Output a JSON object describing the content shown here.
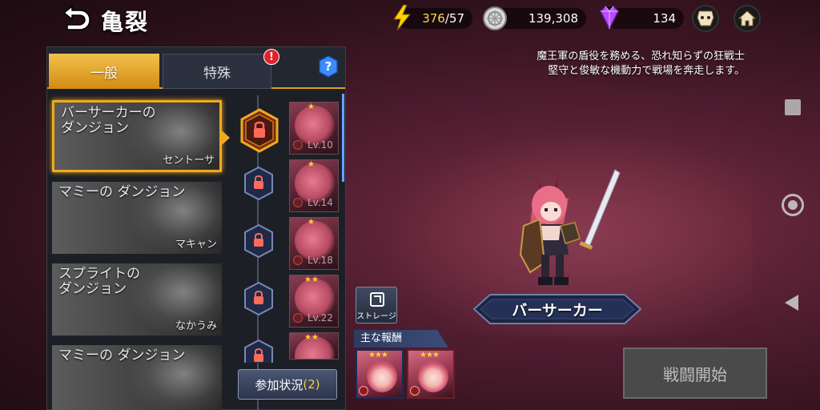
{
  "header": {
    "title": "亀裂",
    "energy_current": "376",
    "energy_max": "/57",
    "gold": "139,308",
    "gems": "134"
  },
  "tabs": [
    {
      "label": "一般",
      "active": true
    },
    {
      "label": "特殊",
      "active": false,
      "alert": "!"
    }
  ],
  "help_label": "?",
  "dungeons": [
    {
      "name": "バーサーカーの\nダンジョン",
      "boss": "セントーサ",
      "selected": true
    },
    {
      "name": "マミーの ダンジョン",
      "boss": "マキャン",
      "selected": false
    },
    {
      "name": "スプライトの\nダンジョン",
      "boss": "なかうみ",
      "selected": false
    },
    {
      "name": "マミーの ダンジョン",
      "boss": "",
      "selected": false
    }
  ],
  "stages": [
    {
      "level": "Lv.10",
      "stars": "★"
    },
    {
      "level": "Lv.14",
      "stars": "★"
    },
    {
      "level": "Lv.18",
      "stars": "★"
    },
    {
      "level": "Lv.22",
      "stars": "★★"
    },
    {
      "level": "",
      "stars": "★★"
    }
  ],
  "join": {
    "label": "参加状況",
    "count": "(2)"
  },
  "character": {
    "description_line1": "魔王軍の盾役を務める、恐れ知らずの狂戦士",
    "description_line2": "堅守と俊敏な機動力で戦場を奔走します。",
    "name": "バーサーカー"
  },
  "storage_label": "ストレージ",
  "rewards": {
    "title": "主な報酬",
    "items": [
      {
        "stars": "★★★"
      },
      {
        "stars": "★★★"
      }
    ]
  },
  "battle_button": "戦闘開始",
  "colors": {
    "accent_gold": "#f0a91e",
    "energy": "#ffd84a",
    "gem": "#b84dff"
  }
}
